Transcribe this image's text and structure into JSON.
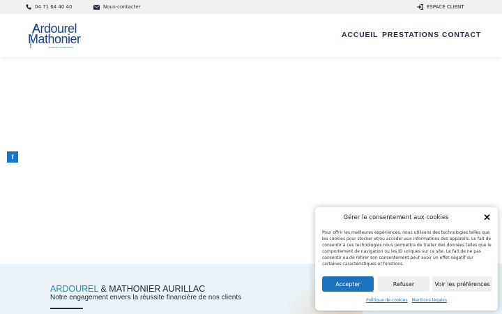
{
  "topbar": {
    "phone": "04 71 64 40 40",
    "contact": "Nous-contacter",
    "client_space": "ESPACE CLIENT"
  },
  "logo": {
    "line1": "Ardourel",
    "line2": "Mathonier",
    "tagline": "experts-comptables"
  },
  "nav": {
    "items": [
      "ACCUEIL",
      "PRESTATIONS",
      "CONTACT"
    ],
    "active": "ACCUEIL"
  },
  "social": {
    "facebook_glyph": "f"
  },
  "hero": {
    "title_part1": "ARDOUREL",
    "title_part2": "& MATHONIER AURILLAC",
    "subtitle": "Notre engagement envers la réussite financière de nos clients"
  },
  "cookie": {
    "title": "Gérer le consentement aux cookies",
    "text": "Pour offrir les meilleures expériences, nous utilisons des technologies telles que les cookies pour stocker et/ou accéder aux informations des appareils. Le fait de consentir à ces technologies nous permettra de traiter des données telles que le comportement de navigation ou les ID uniques sur ce site. Le fait de ne pas consentir ou de retirer son consentement peut avoir un effet négatif sur certaines caractéristiques et fonctions.",
    "accept": "Accepter",
    "refuse": "Refuser",
    "preferences": "Voir les préférences",
    "cookie_policy": "Politique de cookies",
    "legal": "Mentions légales"
  },
  "colors": {
    "accent": "#2d8aa6",
    "brand": "#1f3f8a",
    "button": "#1e73be",
    "facebook": "#1877c9"
  }
}
